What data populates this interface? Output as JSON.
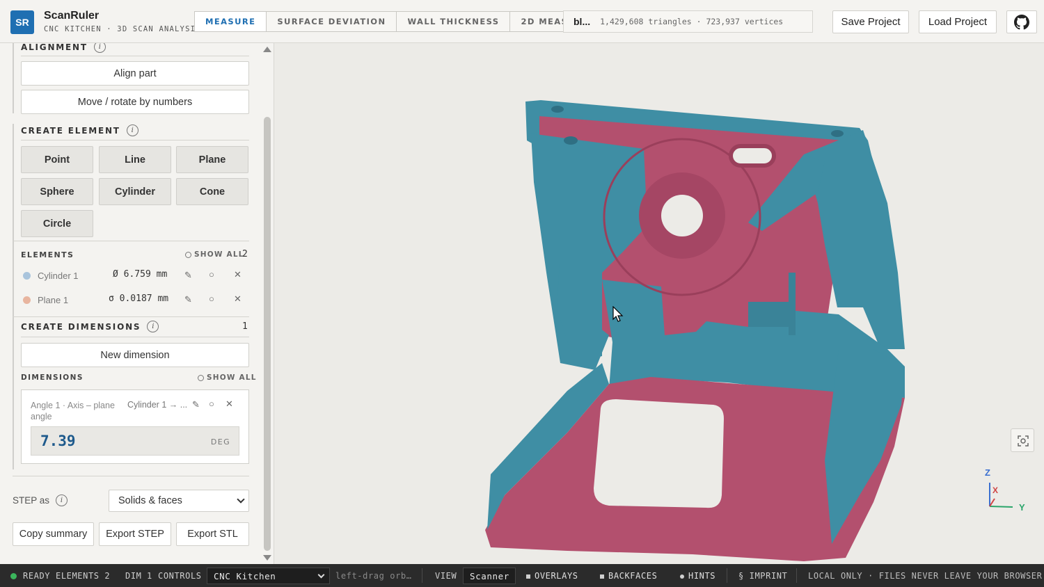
{
  "app": {
    "logo": "SR",
    "title": "ScanRuler",
    "subtitle": "CNC KITCHEN · 3D SCAN ANALYSIS"
  },
  "tabs": [
    {
      "label": "MEASURE",
      "active": true
    },
    {
      "label": "SURFACE DEVIATION",
      "active": false
    },
    {
      "label": "WALL THICKNESS",
      "active": false
    },
    {
      "label": "2D MEASURE",
      "active": false
    }
  ],
  "mesh": {
    "file": "bl...",
    "stats": "1,429,608 triangles · 723,937 vertices"
  },
  "header_buttons": {
    "save": "Save Project",
    "load": "Load Project",
    "github_icon": "github-icon"
  },
  "alignment": {
    "title": "ALIGNMENT",
    "info": "i",
    "align_part": "Align part",
    "move_rotate": "Move / rotate by numbers"
  },
  "create_element": {
    "title": "CREATE ELEMENT",
    "info": "i",
    "buttons": [
      "Point",
      "Line",
      "Plane",
      "Sphere",
      "Cylinder",
      "Cone",
      "Circle"
    ]
  },
  "elements": {
    "title": "ELEMENTS",
    "show_all": "SHOW ALL",
    "count": "2",
    "items": [
      {
        "name": "Cylinder 1",
        "value": "Ø 6.759 mm",
        "color": "#a9c4dc"
      },
      {
        "name": "Plane 1",
        "value": "σ 0.0187 mm",
        "color": "#e8b59f"
      }
    ]
  },
  "create_dimensions": {
    "title": "CREATE DIMENSIONS",
    "info": "i",
    "count": "1",
    "new_dimension": "New dimension"
  },
  "dimensions": {
    "title": "DIMENSIONS",
    "show_all": "SHOW ALL",
    "card": {
      "name": "Angle 1 · Axis – plane angle",
      "ref": "Cylinder 1 → ...",
      "value": "7.39",
      "unit": "DEG"
    }
  },
  "export": {
    "step_label": "STEP as",
    "info": "i",
    "step_option": "Solids & faces",
    "copy_summary": "Copy summary",
    "export_step": "Export STEP",
    "export_stl": "Export STL"
  },
  "axes": {
    "z": "Z",
    "x": "X",
    "y": "Y"
  },
  "colors": {
    "accent": "#1f6fb2",
    "mesh_blue": "#3f8ea4",
    "mesh_pink": "#b3506e",
    "status_green": "#3bb55c"
  },
  "status": {
    "ready": "READY",
    "elements": "ELEMENTS 2",
    "dims": "DIM",
    "dims_count": "1",
    "controls": "CONTROLS",
    "controls_preset": "CNC Kitchen",
    "hint": "left-drag orb…",
    "view": "VIEW",
    "view_value": "Scanner b",
    "overlays": "OVERLAYS",
    "backfaces": "BACKFACES",
    "hints": "HINTS",
    "imprint": "§ IMPRINT",
    "local": "LOCAL ONLY · FILES NEVER LEAVE YOUR BROWSER"
  }
}
